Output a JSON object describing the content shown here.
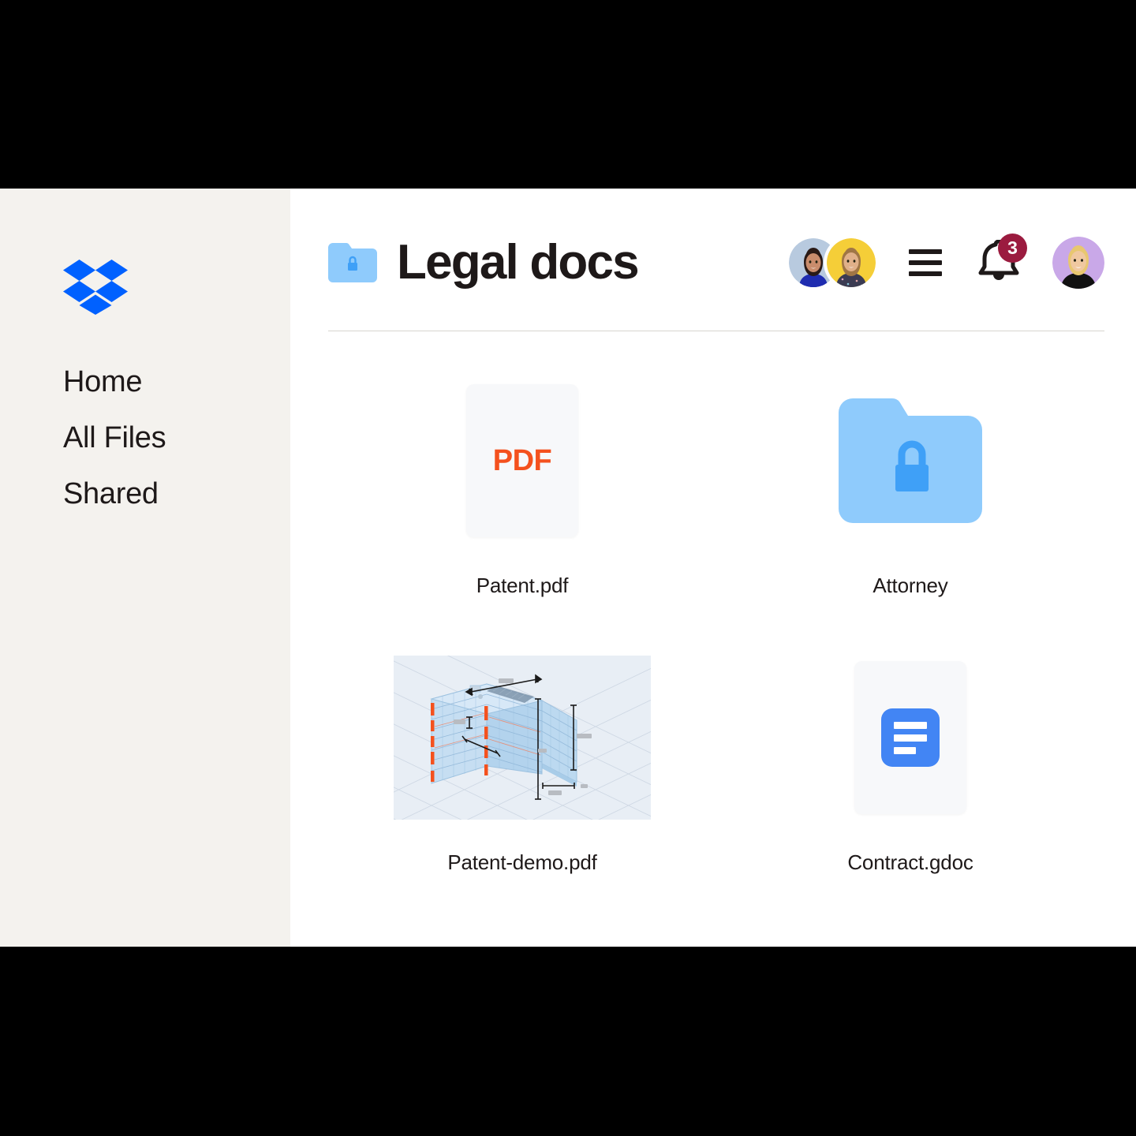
{
  "app": {
    "brand": "Dropbox",
    "brand_logo_icon": "dropbox-logo-icon",
    "brand_color": "#0061FF"
  },
  "sidebar": {
    "background_color": "#F4F2EE",
    "items": [
      {
        "label": "Home",
        "icon": "home-icon"
      },
      {
        "label": "All Files",
        "icon": "files-icon"
      },
      {
        "label": "Shared",
        "icon": "shared-icon"
      }
    ]
  },
  "header": {
    "folder_icon": "locked-folder-icon",
    "title": "Legal docs",
    "menu_icon": "hamburger-menu-icon",
    "notifications": {
      "icon": "bell-icon",
      "count": "3",
      "badge_color": "#9B1B3F"
    },
    "shared_with": [
      {
        "name": "member-avatar-1",
        "background_color": "#B8CADF"
      },
      {
        "name": "member-avatar-2",
        "background_color": "#F5CE38"
      }
    ],
    "profile": {
      "name": "profile-avatar",
      "background_color": "#C9A8E8"
    }
  },
  "files": [
    {
      "name": "Patent.pdf",
      "type": "pdf",
      "thumbnail": "pdf-file-icon",
      "badge_text": "PDF",
      "badge_color": "#F4511E"
    },
    {
      "name": "Attorney",
      "type": "folder",
      "thumbnail": "locked-folder-icon",
      "badge_text": "",
      "badge_color": "#8FCBFC"
    },
    {
      "name": "Patent-demo.pdf",
      "type": "pdf",
      "thumbnail": "cad-building-preview",
      "badge_text": "",
      "badge_color": "#E8EEF5"
    },
    {
      "name": "Contract.gdoc",
      "type": "gdoc",
      "thumbnail": "google-docs-icon",
      "badge_text": "",
      "badge_color": "#4285F4"
    }
  ]
}
